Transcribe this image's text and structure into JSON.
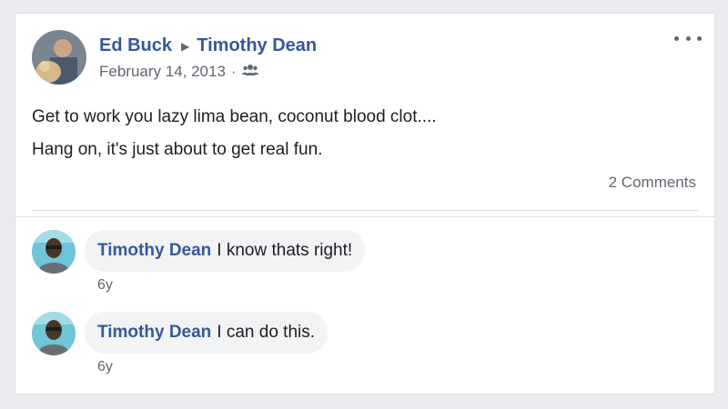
{
  "post": {
    "author": "Ed Buck",
    "recipient": "Timothy Dean",
    "date": "February 14, 2013",
    "audience_icon": "friends-icon",
    "more_icon": "more-options-icon",
    "lines": [
      "Get to work you lazy lima bean, coconut blood clot....",
      "Hang on, it's just about to get real fun."
    ],
    "comments_count": "2 Comments"
  },
  "comments": [
    {
      "author": "Timothy Dean",
      "text": "I know thats right!",
      "time": "6y"
    },
    {
      "author": "Timothy Dean",
      "text": "I can do this.",
      "time": "6y"
    }
  ],
  "colors": {
    "link": "#365899",
    "secondary_text": "#606770",
    "bubble": "#f2f3f5"
  }
}
